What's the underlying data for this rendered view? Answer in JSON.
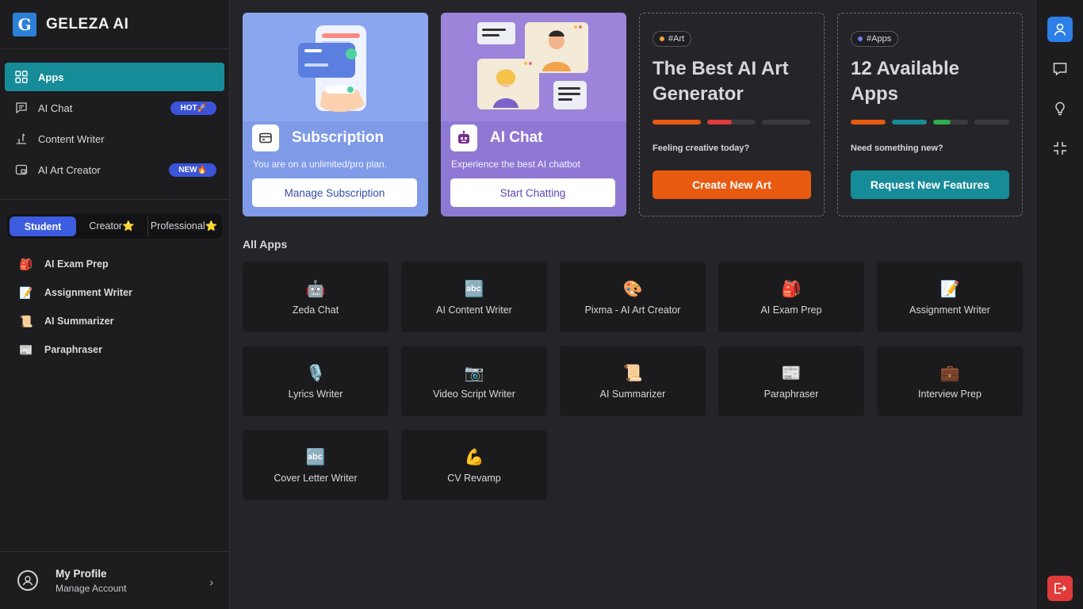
{
  "brand": {
    "name": "GELEZA AI",
    "logo_letter": "G"
  },
  "nav": [
    {
      "label": "Apps",
      "icon": "grid-icon",
      "active": true
    },
    {
      "label": "AI Chat",
      "icon": "chat-icon",
      "badge": "HOT🚀"
    },
    {
      "label": "Content Writer",
      "icon": "pen-icon"
    },
    {
      "label": "AI Art Creator",
      "icon": "image-icon",
      "badge": "NEW🔥"
    }
  ],
  "tabs": [
    "Student",
    "Creator⭐",
    "Professional⭐"
  ],
  "student_apps": [
    {
      "emoji": "🎒",
      "label": "AI Exam Prep"
    },
    {
      "emoji": "📝",
      "label": "Assignment Writer"
    },
    {
      "emoji": "📜",
      "label": "AI Summarizer"
    },
    {
      "emoji": "📰",
      "label": "Paraphraser"
    }
  ],
  "profile": {
    "name": "My Profile",
    "sub": "Manage Account"
  },
  "cards": {
    "subscription": {
      "title": "Subscription",
      "desc": "You are on a unlimited/pro plan.",
      "button": "Manage Subscription"
    },
    "chat": {
      "title": "AI Chat",
      "desc": "Experience the best AI chatbot",
      "button": "Start Chatting"
    },
    "art": {
      "tag": "#Art",
      "title": "The Best AI Art Generator",
      "sub": "Feeling creative today?",
      "button": "Create New Art"
    },
    "apps": {
      "tag": "#Apps",
      "title": "12 Available Apps",
      "sub": "Need something new?",
      "button": "Request New Features"
    }
  },
  "all_apps_title": "All Apps",
  "apps": [
    {
      "emoji": "🤖",
      "label": "Zeda Chat"
    },
    {
      "emoji": "🔤",
      "label": "AI Content Writer"
    },
    {
      "emoji": "🎨",
      "label": "Pixma - AI Art Creator"
    },
    {
      "emoji": "🎒",
      "label": "AI Exam Prep"
    },
    {
      "emoji": "📝",
      "label": "Assignment Writer"
    },
    {
      "emoji": "🎙️",
      "label": "Lyrics Writer"
    },
    {
      "emoji": "📷",
      "label": "Video Script Writer"
    },
    {
      "emoji": "📜",
      "label": "AI Summarizer"
    },
    {
      "emoji": "📰",
      "label": "Paraphraser"
    },
    {
      "emoji": "💼",
      "label": "Interview Prep"
    },
    {
      "emoji": "🔤",
      "label": "Cover Letter Writer"
    },
    {
      "emoji": "💪",
      "label": "CV Revamp"
    }
  ],
  "colors": {
    "accent": "#178c99",
    "orange": "#e85a10",
    "blue": "#3d5ce0"
  }
}
